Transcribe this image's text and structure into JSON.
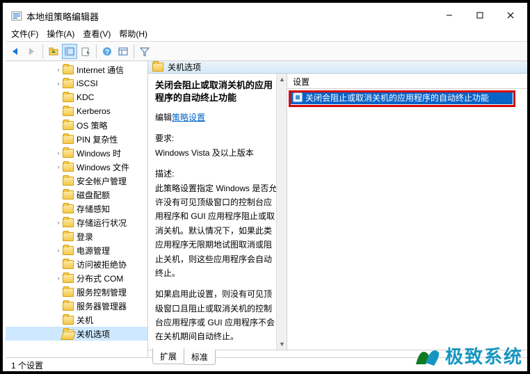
{
  "window": {
    "title": "本地组策略编辑器"
  },
  "menu": {
    "file": "文件(F)",
    "action": "操作(A)",
    "view": "查看(V)",
    "help": "帮助(H)"
  },
  "tree": {
    "items": [
      {
        "label": "Internet 通信",
        "exp": "›"
      },
      {
        "label": "iSCSI",
        "exp": "›"
      },
      {
        "label": "KDC",
        "exp": ""
      },
      {
        "label": "Kerberos",
        "exp": ""
      },
      {
        "label": "OS 策略",
        "exp": ""
      },
      {
        "label": "PIN 复杂性",
        "exp": ""
      },
      {
        "label": "Windows 时",
        "exp": "›"
      },
      {
        "label": "Windows 文件",
        "exp": "›"
      },
      {
        "label": "安全帐户管理",
        "exp": ""
      },
      {
        "label": "磁盘配额",
        "exp": ""
      },
      {
        "label": "存储感知",
        "exp": ""
      },
      {
        "label": "存储运行状况",
        "exp": "›"
      },
      {
        "label": "登录",
        "exp": ""
      },
      {
        "label": "电源管理",
        "exp": "›"
      },
      {
        "label": "访问被拒绝协",
        "exp": ""
      },
      {
        "label": "分布式 COM",
        "exp": "›"
      },
      {
        "label": "服务控制管理",
        "exp": ""
      },
      {
        "label": "服务器管理器",
        "exp": ""
      },
      {
        "label": "关机",
        "exp": ""
      },
      {
        "label": "关机选项",
        "exp": "",
        "selected": true
      }
    ]
  },
  "content": {
    "header": "关机选项",
    "policy_title": "关闭会阻止或取消关机的应用程序的自动终止功能",
    "edit_prefix": "编辑",
    "edit_link": "策略设置",
    "req_label": "要求:",
    "req_value": "Windows Vista 及以上版本",
    "desc_label": "描述:",
    "desc_p1": "此策略设置指定 Windows 是否允许没有可见顶级窗口的控制台应用程序和 GUI 应用程序阻止或取消关机。默认情况下，如果此类应用程序无限期地试图取消或阻止关机，则这些应用程序会自动终止。",
    "desc_p2": "如果启用此设置，则没有可见顶级窗口且阻止或取消关机的控制台应用程序或 GUI 应用程序不会在关机期间自动终止。"
  },
  "list": {
    "column": "设置",
    "item": "关闭会阻止或取消关机的应用程序的自动终止功能"
  },
  "tabs": {
    "extended": "扩展",
    "standard": "标准"
  },
  "status": "1 个设置",
  "watermark": "极致系统"
}
